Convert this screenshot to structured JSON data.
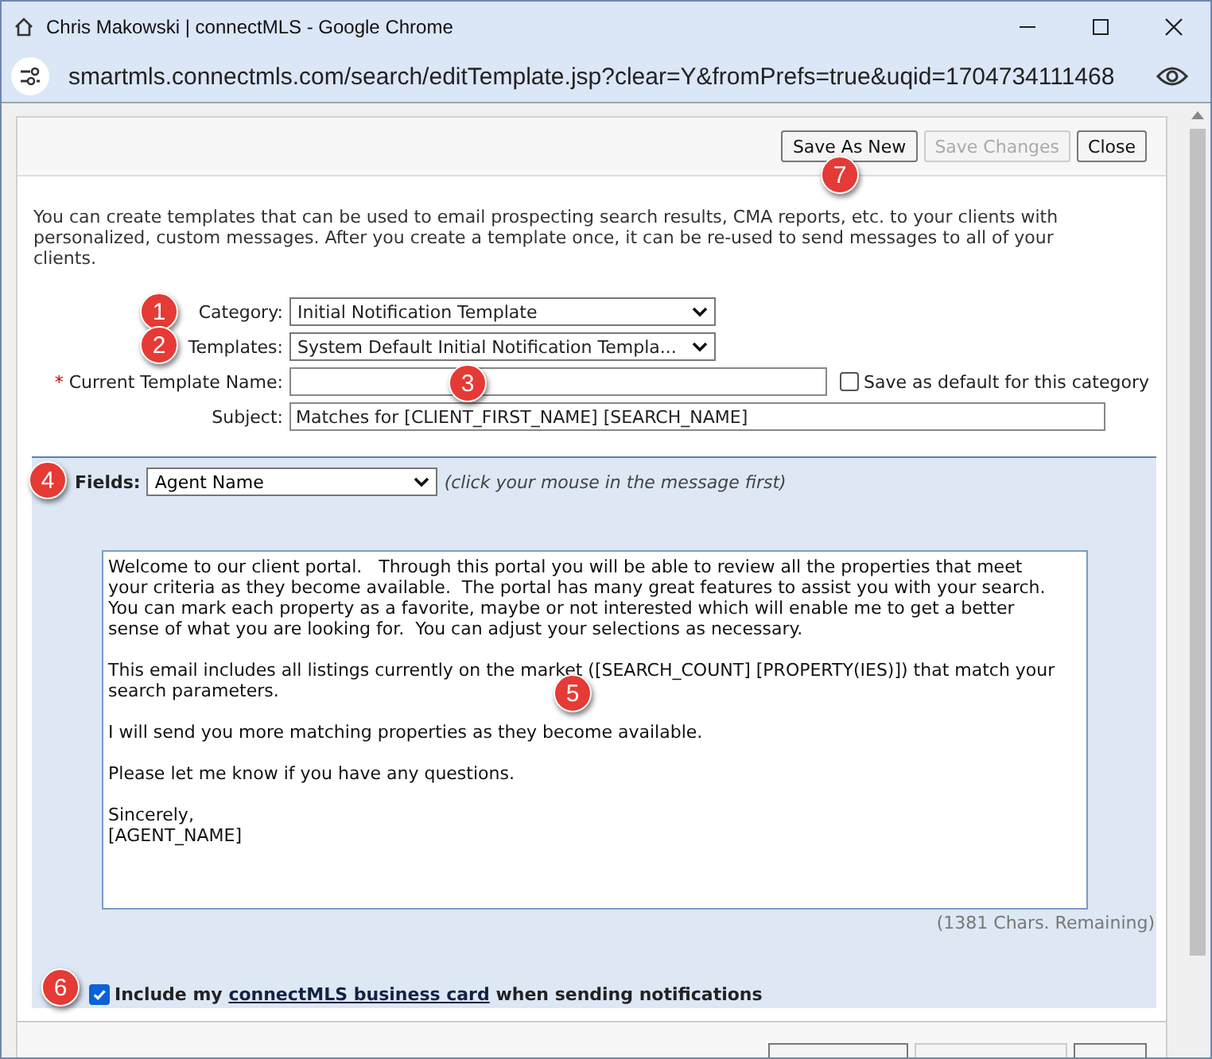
{
  "window": {
    "title": "Chris Makowski | connectMLS - Google Chrome"
  },
  "address_bar": {
    "url": "smartmls.connectmls.com/search/editTemplate.jsp?clear=Y&fromPrefs=true&uqid=1704734111468"
  },
  "toolbar": {
    "buttons": [
      {
        "label": "Save As New",
        "disabled": false
      },
      {
        "label": "Save Changes",
        "disabled": true
      },
      {
        "label": "Close",
        "disabled": false
      }
    ]
  },
  "intro": "You can create templates that can be used to email prospecting search results, CMA reports, etc. to your clients with personalized, custom messages. After you create a template once, it can be re-used to send messages to all of your clients.",
  "form": {
    "category": {
      "label": "Category:",
      "value": "Initial Notification Template"
    },
    "templates": {
      "label": "Templates:",
      "value": "System Default Initial Notification Templa..."
    },
    "template_name": {
      "required_mark": "*",
      "label": "Current Template Name:"
    },
    "save_default": {
      "label": "Save as default for this category",
      "checked": false
    },
    "subject": {
      "label": "Subject:",
      "value": "Matches for [CLIENT_FIRST_NAME] [SEARCH_NAME]"
    }
  },
  "fields_panel": {
    "label": "Fields:",
    "value": "Agent Name",
    "hint": "(click your mouse in the message first)",
    "message": "Welcome to our client portal.   Through this portal you will be able to review all the properties that meet your criteria as they become available.  The portal has many great features to assist you with your search.  You can mark each property as a favorite, maybe or not interested which will enable me to get a better sense of what you are looking for.  You can adjust your selections as necessary.\n\nThis email includes all listings currently on the market ([SEARCH_COUNT] [PROPERTY(IES)]) that match your search parameters.\n\nI will send you more matching properties as they become available.\n\nPlease let me know if you have any questions.\n\nSincerely,\n[AGENT_NAME]",
    "remaining": "(1381 Chars. Remaining)",
    "business_card": {
      "checked": true,
      "before": "Include my",
      "link": "connectMLS business card",
      "after": "when sending notifications"
    }
  },
  "callouts": [
    "1",
    "2",
    "3",
    "4",
    "5",
    "6",
    "7"
  ]
}
